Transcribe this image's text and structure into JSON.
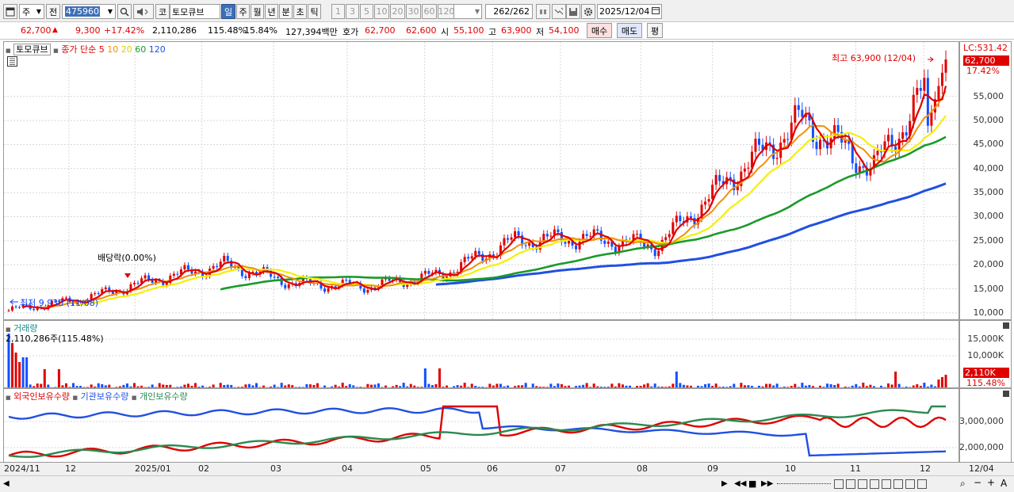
{
  "toolbar": {
    "period_type": "주",
    "prev_label": "전",
    "code_value": "475960",
    "market_label": "코",
    "stock_name": "토모큐브",
    "period_buttons": [
      "일",
      "주",
      "월",
      "년",
      "분",
      "초",
      "틱"
    ],
    "interval_buttons": [
      "1",
      "3",
      "5",
      "10",
      "20",
      "30",
      "60",
      "120"
    ],
    "count_current": "262",
    "count_total": "/262",
    "date_value": "2025/12/04"
  },
  "quote": {
    "price": "62,700",
    "change": "9,300",
    "change_pct": "+17.42%",
    "volume": "2,110,286",
    "volume_ratio": "115.48%",
    "turnover": "15.84%",
    "amount": "127,394백만",
    "bid_label": "호가",
    "bid1": "62,700",
    "bid2": "62,600",
    "open_label": "시",
    "open": "55,100",
    "high_label": "고",
    "high": "63,900",
    "low_label": "저",
    "low": "54,100",
    "buy_label": "매수",
    "sell_label": "매도",
    "eval_label": "평"
  },
  "price_panel": {
    "name_tag": "토모큐브",
    "legend_main": "종가 단순",
    "ma_periods": [
      "5",
      "10",
      "20",
      "60",
      "120"
    ],
    "lc_label": "LC:531.42",
    "price_tag": "62,700",
    "pct_tag": "17.42%",
    "high_note": "최고 63,900 (12/04)",
    "low_note": "최저 9,930 (11/08)",
    "dividend_note": "배당락(0.00%)",
    "y_ticks": [
      "55,000",
      "50,000",
      "45,000",
      "40,000",
      "35,000",
      "30,000",
      "25,000",
      "20,000",
      "15,000",
      "10,000"
    ]
  },
  "volume_panel": {
    "title": "거래량",
    "value_note": "2,110,286주(115.48%)",
    "y_ticks": [
      "15,000K",
      "10,000K"
    ],
    "vol_tag": "2,110K",
    "pct_tag": "115.48%"
  },
  "holding_panel": {
    "legends": [
      "외국인보유수량",
      "기관보유수량",
      "개인보유수량"
    ],
    "y_ticks": [
      "3,000,000",
      "2,000,000"
    ]
  },
  "x_axis": {
    "labels": [
      "2024/11",
      "12",
      "2025/01",
      "02",
      "03",
      "04",
      "05",
      "06",
      "07",
      "08",
      "09",
      "10",
      "11",
      "12"
    ],
    "last_date": "12/04"
  },
  "colors": {
    "up": "#e00000",
    "down": "#1050ff",
    "ma5": "#e00000",
    "ma10": "#f0900a",
    "ma20": "#f5f000",
    "ma60": "#1a9a2a",
    "ma120": "#2050e0",
    "foreign": "#e00000",
    "institution": "#2050e0",
    "individual": "#2a8a50"
  },
  "chart_data": {
    "type": "line",
    "title": "토모큐브",
    "x": [
      "2024/11",
      "12",
      "2025/01",
      "02",
      "03",
      "04",
      "05",
      "06",
      "07",
      "08",
      "09",
      "10",
      "11",
      "12"
    ],
    "series": [
      {
        "name": "종가",
        "values": [
          10500,
          12800,
          16800,
          20000,
          16000,
          15500,
          18000,
          25000,
          25500,
          24000,
          38000,
          50000,
          40000,
          62700
        ]
      },
      {
        "name": "60",
        "values": [
          null,
          null,
          null,
          15000,
          16500,
          17000,
          16800,
          20000,
          23500,
          25000,
          28000,
          35000,
          42000,
          44500
        ]
      },
      {
        "name": "120",
        "values": [
          null,
          null,
          null,
          null,
          null,
          null,
          15800,
          18000,
          20500,
          21500,
          24000,
          31000,
          34000,
          36500
        ]
      }
    ],
    "ylim": [
      8000,
      66000
    ],
    "grid": true
  }
}
